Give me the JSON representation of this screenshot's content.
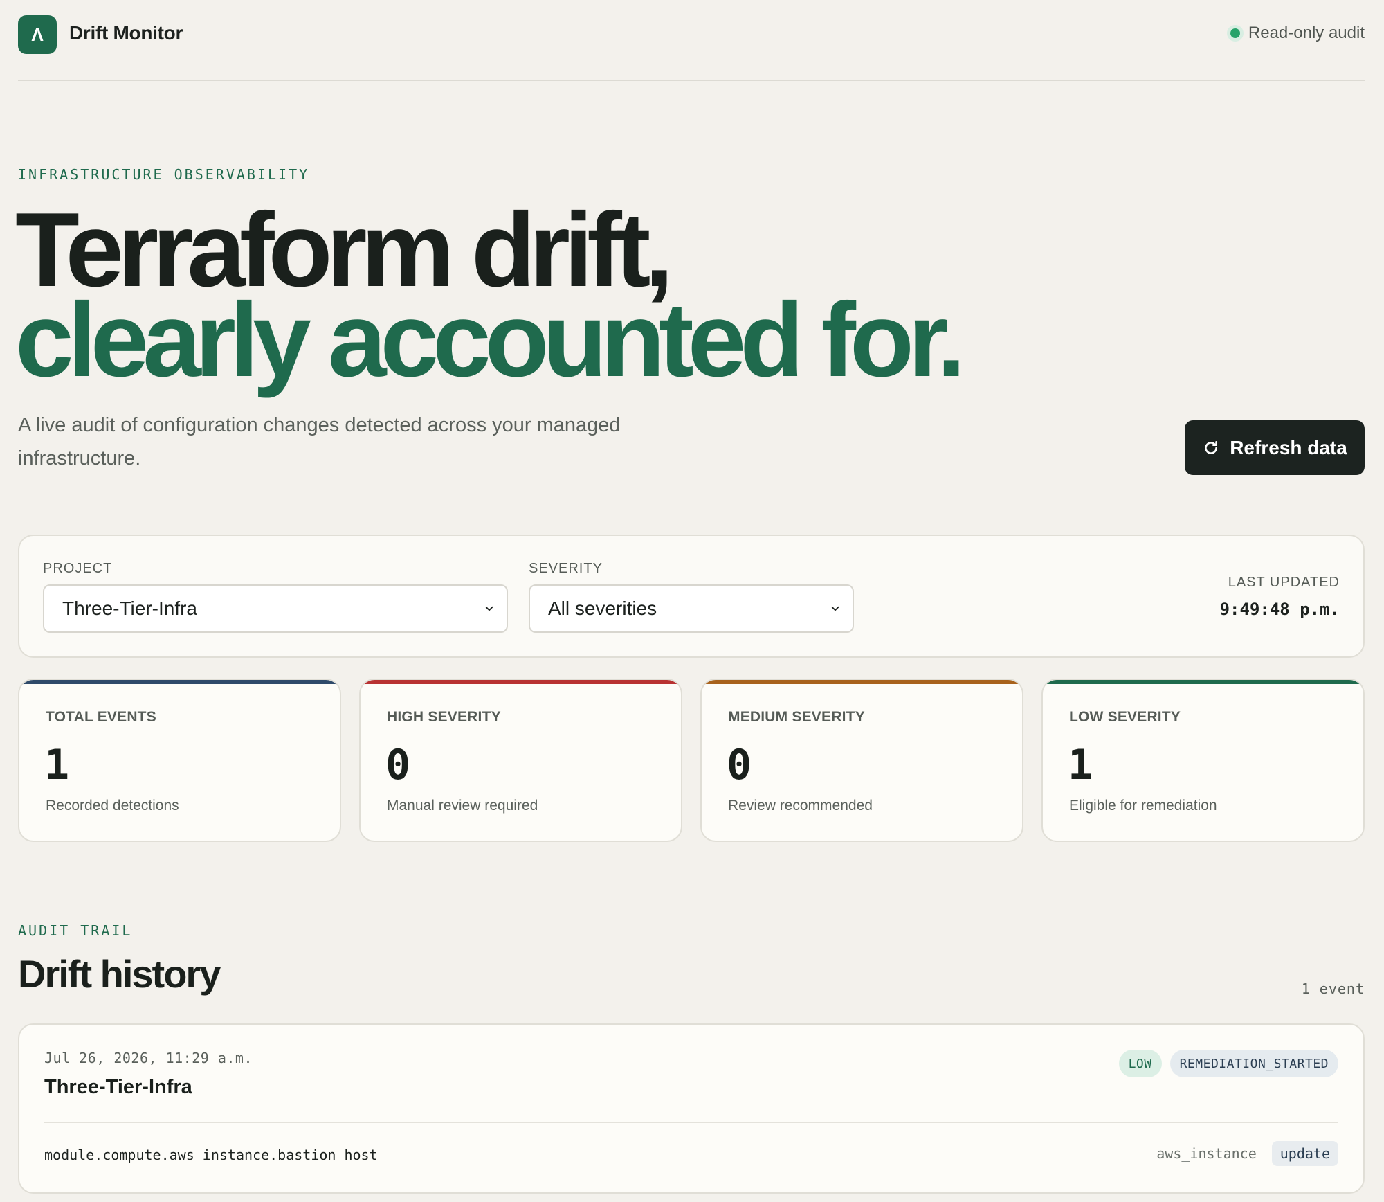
{
  "header": {
    "logo_glyph": "Λ",
    "brand": "Drift Monitor",
    "status_label": "Read-only audit",
    "status_color": "#27a36a"
  },
  "hero": {
    "eyebrow": "INFRASTRUCTURE OBSERVABILITY",
    "title_line1": "Terraform drift,",
    "title_line2": "clearly accounted for.",
    "lead": "A live audit of configuration changes detected across your managed infrastructure.",
    "refresh_label": "Refresh data",
    "refresh_icon": "refresh-icon"
  },
  "filters": {
    "project_label": "PROJECT",
    "project_value": "Three-Tier-Infra",
    "severity_label": "SEVERITY",
    "severity_value": "All severities",
    "last_updated_label": "LAST UPDATED",
    "last_updated_value": "9:49:48 p.m."
  },
  "stats": [
    {
      "title": "TOTAL EVENTS",
      "value": "1",
      "sub": "Recorded detections",
      "color": "#2f4a6a"
    },
    {
      "title": "HIGH SEVERITY",
      "value": "0",
      "sub": "Manual review required",
      "color": "#b83232"
    },
    {
      "title": "MEDIUM SEVERITY",
      "value": "0",
      "sub": "Review recommended",
      "color": "#a8621c"
    },
    {
      "title": "LOW SEVERITY",
      "value": "1",
      "sub": "Eligible for remediation",
      "color": "#1f6a4d"
    }
  ],
  "history": {
    "eyebrow": "AUDIT TRAIL",
    "title": "Drift history",
    "count": "1 event",
    "events": [
      {
        "date": "Jul 26, 2026, 11:29 a.m.",
        "project": "Three-Tier-Infra",
        "severity": "LOW",
        "state": "REMEDIATION_STARTED",
        "resource": "module.compute.aws_instance.bastion_host",
        "type": "aws_instance",
        "action": "update"
      }
    ]
  },
  "colors": {
    "accent": "#1f6a4d",
    "background": "#f3f1ec",
    "dark_button": "#1c2320"
  }
}
